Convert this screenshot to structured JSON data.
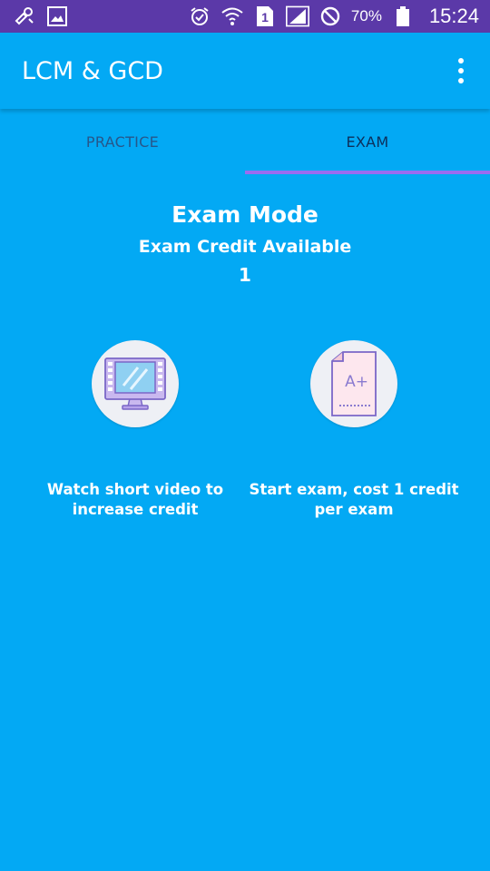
{
  "status_bar": {
    "battery_percent": "70%",
    "time": "15:24",
    "sim_slot": "1",
    "icons": [
      "usb-tools-icon",
      "gallery-icon",
      "alarm-icon",
      "wifi-icon",
      "sim-icon",
      "signal-icon",
      "do-not-disturb-icon",
      "battery-icon"
    ]
  },
  "app_bar": {
    "title": "LCM & GCD",
    "menu_icon": "overflow-menu-icon"
  },
  "tabs": [
    {
      "label": "PRACTICE",
      "active": false
    },
    {
      "label": "EXAM",
      "active": true
    }
  ],
  "exam": {
    "title": "Exam Mode",
    "credit_label": "Exam Credit Available",
    "credit_value": "1"
  },
  "actions": {
    "watch_video": {
      "icon": "monitor-icon",
      "caption": "Watch short video to increase credit"
    },
    "start_exam": {
      "icon": "grade-paper-icon",
      "icon_text": "A+",
      "caption": "Start exam, cost 1 credit per exam"
    }
  },
  "colors": {
    "status_bar": "#5b39a8",
    "primary": "#03a9f4",
    "tab_indicator": "#9a6cf0"
  }
}
